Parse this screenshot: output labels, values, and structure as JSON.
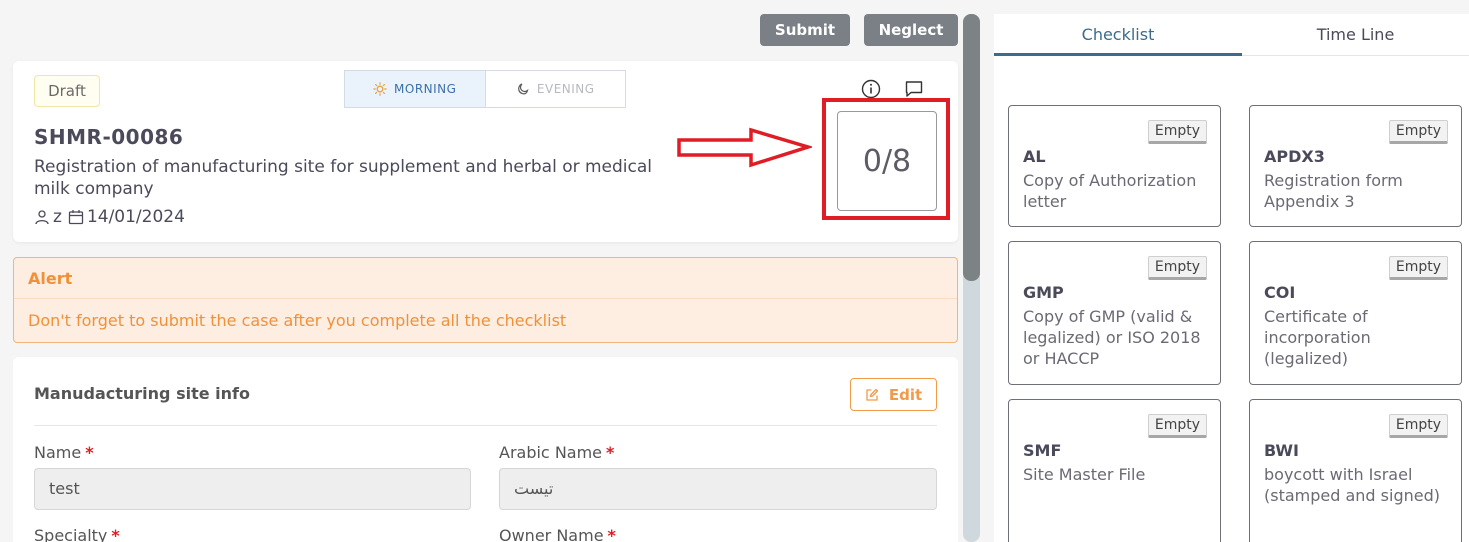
{
  "toolbar": {
    "submit_label": "Submit",
    "neglect_label": "Neglect"
  },
  "case": {
    "status": "Draft",
    "shift_morning": "MORNING",
    "shift_evening": "EVENING",
    "code": "SHMR-00086",
    "description": "Registration of manufacturing site for supplement and herbal or medical milk company",
    "user": "z",
    "date": "14/01/2024",
    "progress": "0/8",
    "icons": [
      "info-icon",
      "comment-icon",
      "sun-icon",
      "moon-icon",
      "user-icon",
      "calendar-icon"
    ]
  },
  "alert": {
    "title": "Alert",
    "message": "Don't forget to submit the case after you complete all the checklist"
  },
  "site_info": {
    "title": "Manudacturing site info",
    "edit_label": "Edit",
    "fields": [
      {
        "label": "Name",
        "value": "test"
      },
      {
        "label": "Arabic Name",
        "value": "تيست"
      },
      {
        "label": "Specialty"
      },
      {
        "label": "Owner Name"
      }
    ]
  },
  "tabs": {
    "checklist": "Checklist",
    "timeline": "Time Line"
  },
  "checklist": [
    {
      "badge": "Empty",
      "code": "AL",
      "description": "Copy of Authorization letter"
    },
    {
      "badge": "Empty",
      "code": "APDX3",
      "description": "Registration form Appendix 3"
    },
    {
      "badge": "Empty",
      "code": "GMP",
      "description": "Copy of GMP (valid & legalized) or ISO 2018 or HACCP"
    },
    {
      "badge": "Empty",
      "code": "COI",
      "description": "Certificate of incorporation (legalized)"
    },
    {
      "badge": "Empty",
      "code": "SMF",
      "description": "Site Master File"
    },
    {
      "badge": "Empty",
      "code": "BWI",
      "description": "boycott with Israel (stamped and signed)"
    }
  ],
  "colors": {
    "accent": "#3b6c8c",
    "alert": "#f0913a",
    "highlight": "#e01c24",
    "button": "#7b7f86"
  }
}
